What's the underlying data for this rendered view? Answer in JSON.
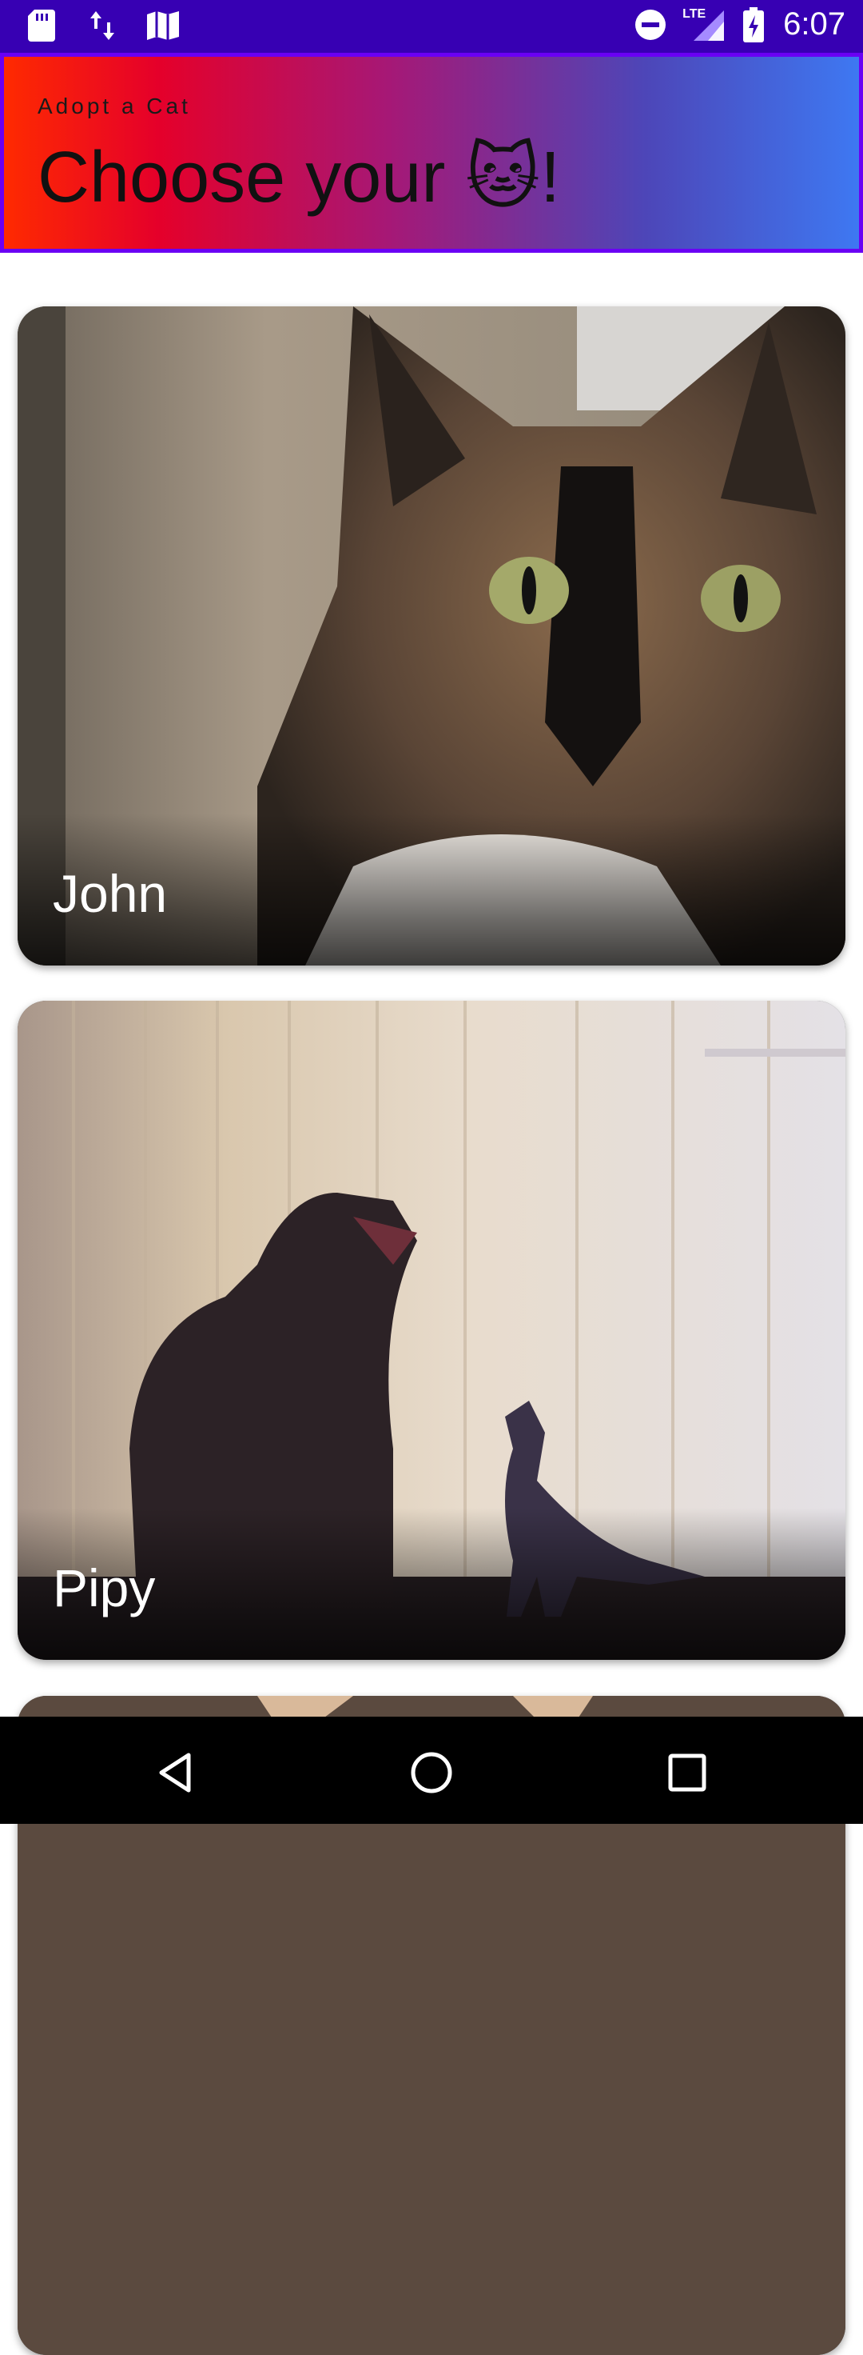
{
  "status_bar": {
    "time": "6:07",
    "network_label": "LTE",
    "left_icons": [
      "sd-card-icon",
      "data-transfer-icon",
      "map-icon"
    ],
    "right_icons": [
      "do-not-disturb-icon",
      "signal-icon",
      "battery-icon"
    ]
  },
  "header": {
    "subtitle": "Adopt a Cat",
    "title": "Choose your 🐱!"
  },
  "cats": [
    {
      "name": "John"
    },
    {
      "name": "Pipy"
    },
    {
      "name": ""
    }
  ],
  "nav_bar": {
    "icons": [
      "back-icon",
      "home-icon",
      "recents-icon"
    ]
  },
  "colors": {
    "status_bar": "#3700b3",
    "header_border": "#6a00f4",
    "header_gradient_start": "#ff2a00",
    "header_gradient_end": "#3e78f2"
  }
}
